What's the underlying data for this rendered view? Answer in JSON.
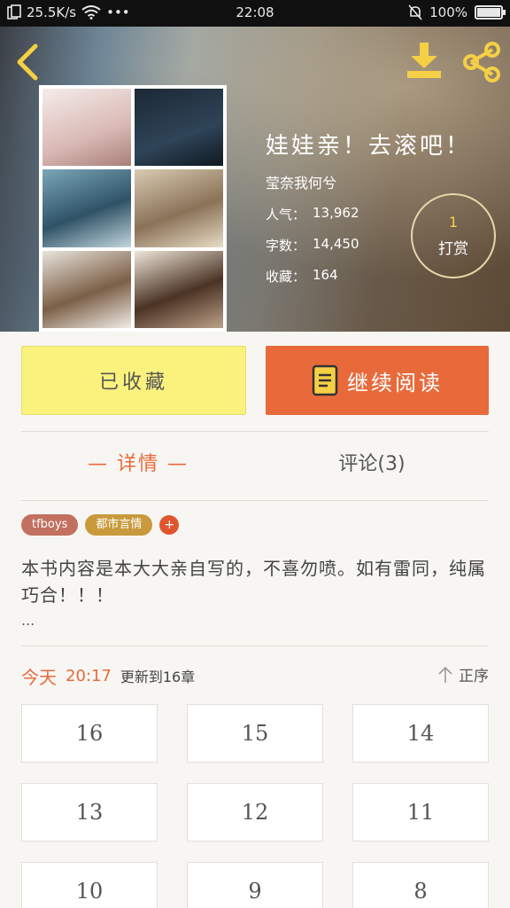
{
  "status_bar": {
    "net_speed": "25.5K/s",
    "dots": "•••",
    "time": "22:08",
    "battery": "100%",
    "battery_level": 1.0
  },
  "header": {
    "book": {
      "title": "娃娃亲！去滚吧！",
      "author": "莹奈我何兮",
      "stats": [
        {
          "label": "人气：",
          "value": "13,962"
        },
        {
          "label": "字数：",
          "value": "14,450"
        },
        {
          "label": "收藏：",
          "value": "164"
        }
      ]
    },
    "tip": {
      "count": "1",
      "label": "打赏"
    }
  },
  "actions": {
    "collected_label": "已收藏",
    "continue_label": "继续阅读"
  },
  "tabs": {
    "details_label": "— 详情 —",
    "comments_label": "评论(3)"
  },
  "tags": [
    {
      "label": "tfboys",
      "color": "#c2705f"
    },
    {
      "label": "都市言情",
      "color": "#c99a3c"
    }
  ],
  "tag_add_label": "+",
  "description": {
    "text": "本书内容是本大大亲自写的，不喜勿喷。如有雷同，纯属巧合！！！",
    "more": "..."
  },
  "update": {
    "today": "今天",
    "time": "20:17",
    "text": "更新到16章",
    "sort_label": "正序"
  },
  "chapters": [
    "16",
    "15",
    "14",
    "13",
    "12",
    "11",
    "10",
    "9",
    "8"
  ],
  "colors": {
    "accent": "#e86a3b",
    "collected_bg": "#fbf27e",
    "tip_count": "#f4d24e",
    "icon_yellow": "#f5cf45"
  }
}
